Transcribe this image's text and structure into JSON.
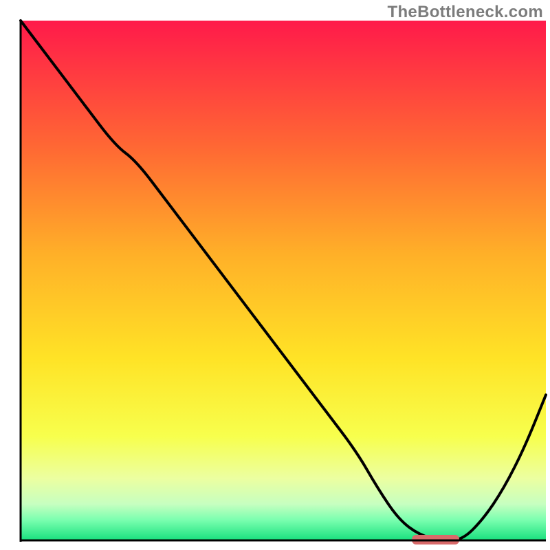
{
  "watermark": "TheBottleneck.com",
  "chart_data": {
    "type": "line",
    "title": "",
    "xlabel": "",
    "ylabel": "",
    "xlim": [
      0,
      100
    ],
    "ylim": [
      0,
      100
    ],
    "axes_visible": false,
    "legend": false,
    "grid": false,
    "background_gradient": {
      "stops": [
        {
          "offset": 0.0,
          "color": "#ff1a4a"
        },
        {
          "offset": 0.25,
          "color": "#ff6a33"
        },
        {
          "offset": 0.45,
          "color": "#ffb028"
        },
        {
          "offset": 0.65,
          "color": "#ffe326"
        },
        {
          "offset": 0.8,
          "color": "#f7ff4d"
        },
        {
          "offset": 0.88,
          "color": "#ecffa0"
        },
        {
          "offset": 0.93,
          "color": "#c7ffc0"
        },
        {
          "offset": 0.96,
          "color": "#7cffb0"
        },
        {
          "offset": 1.0,
          "color": "#18e07e"
        }
      ]
    },
    "series": [
      {
        "name": "curve",
        "description": "V-shaped bottleneck curve",
        "color": "#000000",
        "x": [
          0,
          6,
          12,
          18,
          22,
          28,
          34,
          40,
          46,
          52,
          58,
          64,
          68,
          72,
          76,
          80,
          84,
          88,
          92,
          96,
          100
        ],
        "y": [
          100,
          92,
          84,
          76,
          73,
          65,
          57,
          49,
          41,
          33,
          25,
          17,
          10,
          4,
          1,
          0,
          0,
          4,
          10,
          18,
          28
        ]
      }
    ],
    "marker": {
      "name": "optimal-range",
      "x_center": 79,
      "x_width": 9,
      "y": 0,
      "color": "#d86a6a"
    },
    "frame": {
      "left": true,
      "bottom": true,
      "right": false,
      "top": false,
      "color": "#000000",
      "width": 3
    }
  }
}
